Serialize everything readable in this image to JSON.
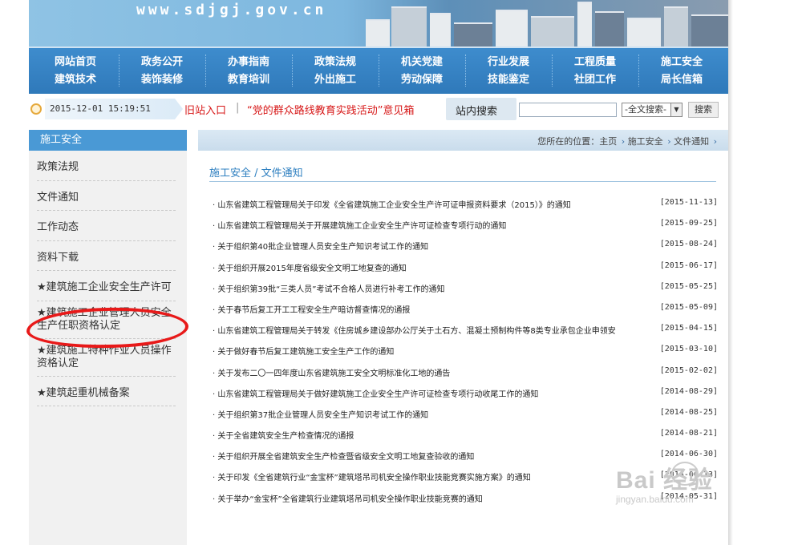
{
  "banner": {
    "url": "www.sdjgj.gov.cn"
  },
  "nav": {
    "columns": [
      [
        "网站首页",
        "建筑技术"
      ],
      [
        "政务公开",
        "装饰装修"
      ],
      [
        "办事指南",
        "教育培训"
      ],
      [
        "政策法规",
        "外出施工"
      ],
      [
        "机关党建",
        "劳动保障"
      ],
      [
        "行业发展",
        "技能鉴定"
      ],
      [
        "工程质量",
        "社团工作"
      ],
      [
        "施工安全",
        "局长信箱"
      ]
    ]
  },
  "infobar": {
    "datetime": "2015-12-01 15:19:51",
    "old_site": "旧站入口",
    "separator": "|",
    "mailbox": "“党的群众路线教育实践活动”意见箱",
    "search_label": "站内搜索",
    "search_value": "",
    "search_scope": "-全文搜索-",
    "search_button": "搜索"
  },
  "sidebar": {
    "title": "施工安全",
    "items": [
      "政策法规",
      "文件通知",
      "工作动态",
      "资料下载",
      "★建筑施工企业安全生产许可",
      "★建筑施工企业管理人员安全生产任职资格认定",
      "★建筑施工特种作业人员操作资格认定",
      "★建筑起重机械备案"
    ]
  },
  "breadcrumb": {
    "prefix": "您所在的位置：",
    "home": "主页",
    "section": "施工安全",
    "page": "文件通知",
    "chev": "›"
  },
  "section": {
    "title": "施工安全 / 文件通知"
  },
  "news": [
    {
      "title": "· 山东省建筑工程管理局关于印发《全省建筑施工企业安全生产许可证申报资料要求（2015）》的通知",
      "date": "[2015-11-13]"
    },
    {
      "title": "· 山东省建筑工程管理局关于开展建筑施工企业安全生产许可证检查专项行动的通知",
      "date": "[2015-09-25]"
    },
    {
      "title": "· 关于组织第40批企业管理人员安全生产知识考试工作的通知",
      "date": "[2015-08-24]"
    },
    {
      "title": "· 关于组织开展2015年度省级安全文明工地复查的通知",
      "date": "[2015-06-17]"
    },
    {
      "title": "· 关于组织第39批“三类人员”考试不合格人员进行补考工作的通知",
      "date": "[2015-05-25]"
    },
    {
      "title": "· 关于春节后复工开工工程安全生产暗访督查情况的通报",
      "date": "[2015-05-09]"
    },
    {
      "title": "· 山东省建筑工程管理局关于转发《住房城乡建设部办公厅关于土石方、混凝土预制构件等8类专业承包企业申领安",
      "date": "[2015-04-15]"
    },
    {
      "title": "· 关于做好春节后复工建筑施工安全生产工作的通知",
      "date": "[2015-03-10]"
    },
    {
      "title": "· 关于发布二〇一四年度山东省建筑施工安全文明标准化工地的通告",
      "date": "[2015-02-02]"
    },
    {
      "title": "· 山东省建筑工程管理局关于做好建筑施工企业安全生产许可证检查专项行动收尾工作的通知",
      "date": "[2014-08-29]"
    },
    {
      "title": "· 关于组织第37批企业管理人员安全生产知识考试工作的通知",
      "date": "[2014-08-25]"
    },
    {
      "title": "· 关于全省建筑安全生产检查情况的通报",
      "date": "[2014-08-21]"
    },
    {
      "title": "· 关于组织开展全省建筑安全生产检查暨省级安全文明工地复查验收的通知",
      "date": "[2014-06-30]"
    },
    {
      "title": "· 关于印发《全省建筑行业“金宝杯”建筑塔吊司机安全操作职业技能竞赛实施方案》的通知",
      "date": "[2014-06-13]"
    },
    {
      "title": "· 关于举办“金宝杯”全省建筑行业建筑塔吊司机安全操作职业技能竞赛的通知",
      "date": "[2014-05-31]"
    }
  ],
  "watermark": {
    "logo": "Bai 经验",
    "url": "jingyan.baidu.com"
  }
}
